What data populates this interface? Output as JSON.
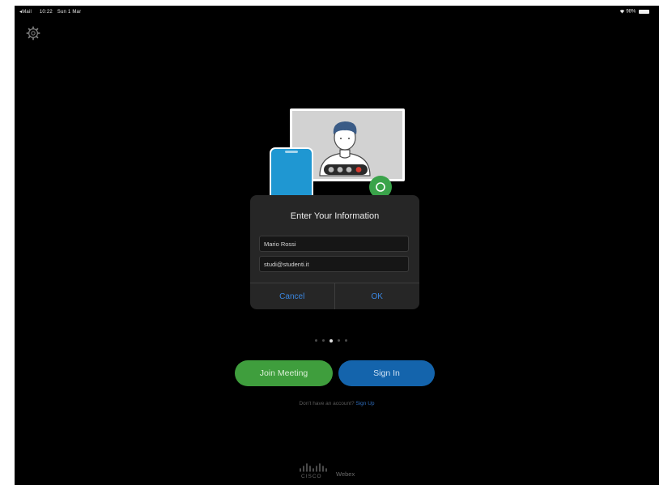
{
  "status_bar": {
    "carrier": "◂Mail",
    "time": "10:22",
    "date": "Sun 1 Mar",
    "battery": "98%"
  },
  "dialog": {
    "title": "Enter Your Information",
    "name_value": "Mario Rossi",
    "email_value": "studi@studenti.it",
    "cancel_label": "Cancel",
    "ok_label": "OK"
  },
  "pager": {
    "count": 5,
    "active_index": 2
  },
  "buttons": {
    "join": "Join Meeting",
    "signin": "Sign In"
  },
  "signup": {
    "prompt": "Don't have an account?",
    "link": "Sign Up"
  },
  "footer": {
    "cisco": "CISCO",
    "webex": "Webex"
  },
  "colors": {
    "background": "#000000",
    "dialog": "#262626",
    "accent_blue": "#3a86e0",
    "join_green": "#3f9e3d",
    "signin_blue": "#1464ac"
  },
  "icons": [
    "gear-icon",
    "wifi-icon",
    "battery-icon",
    "video-call-illustration",
    "cisco-logo-icon"
  ]
}
